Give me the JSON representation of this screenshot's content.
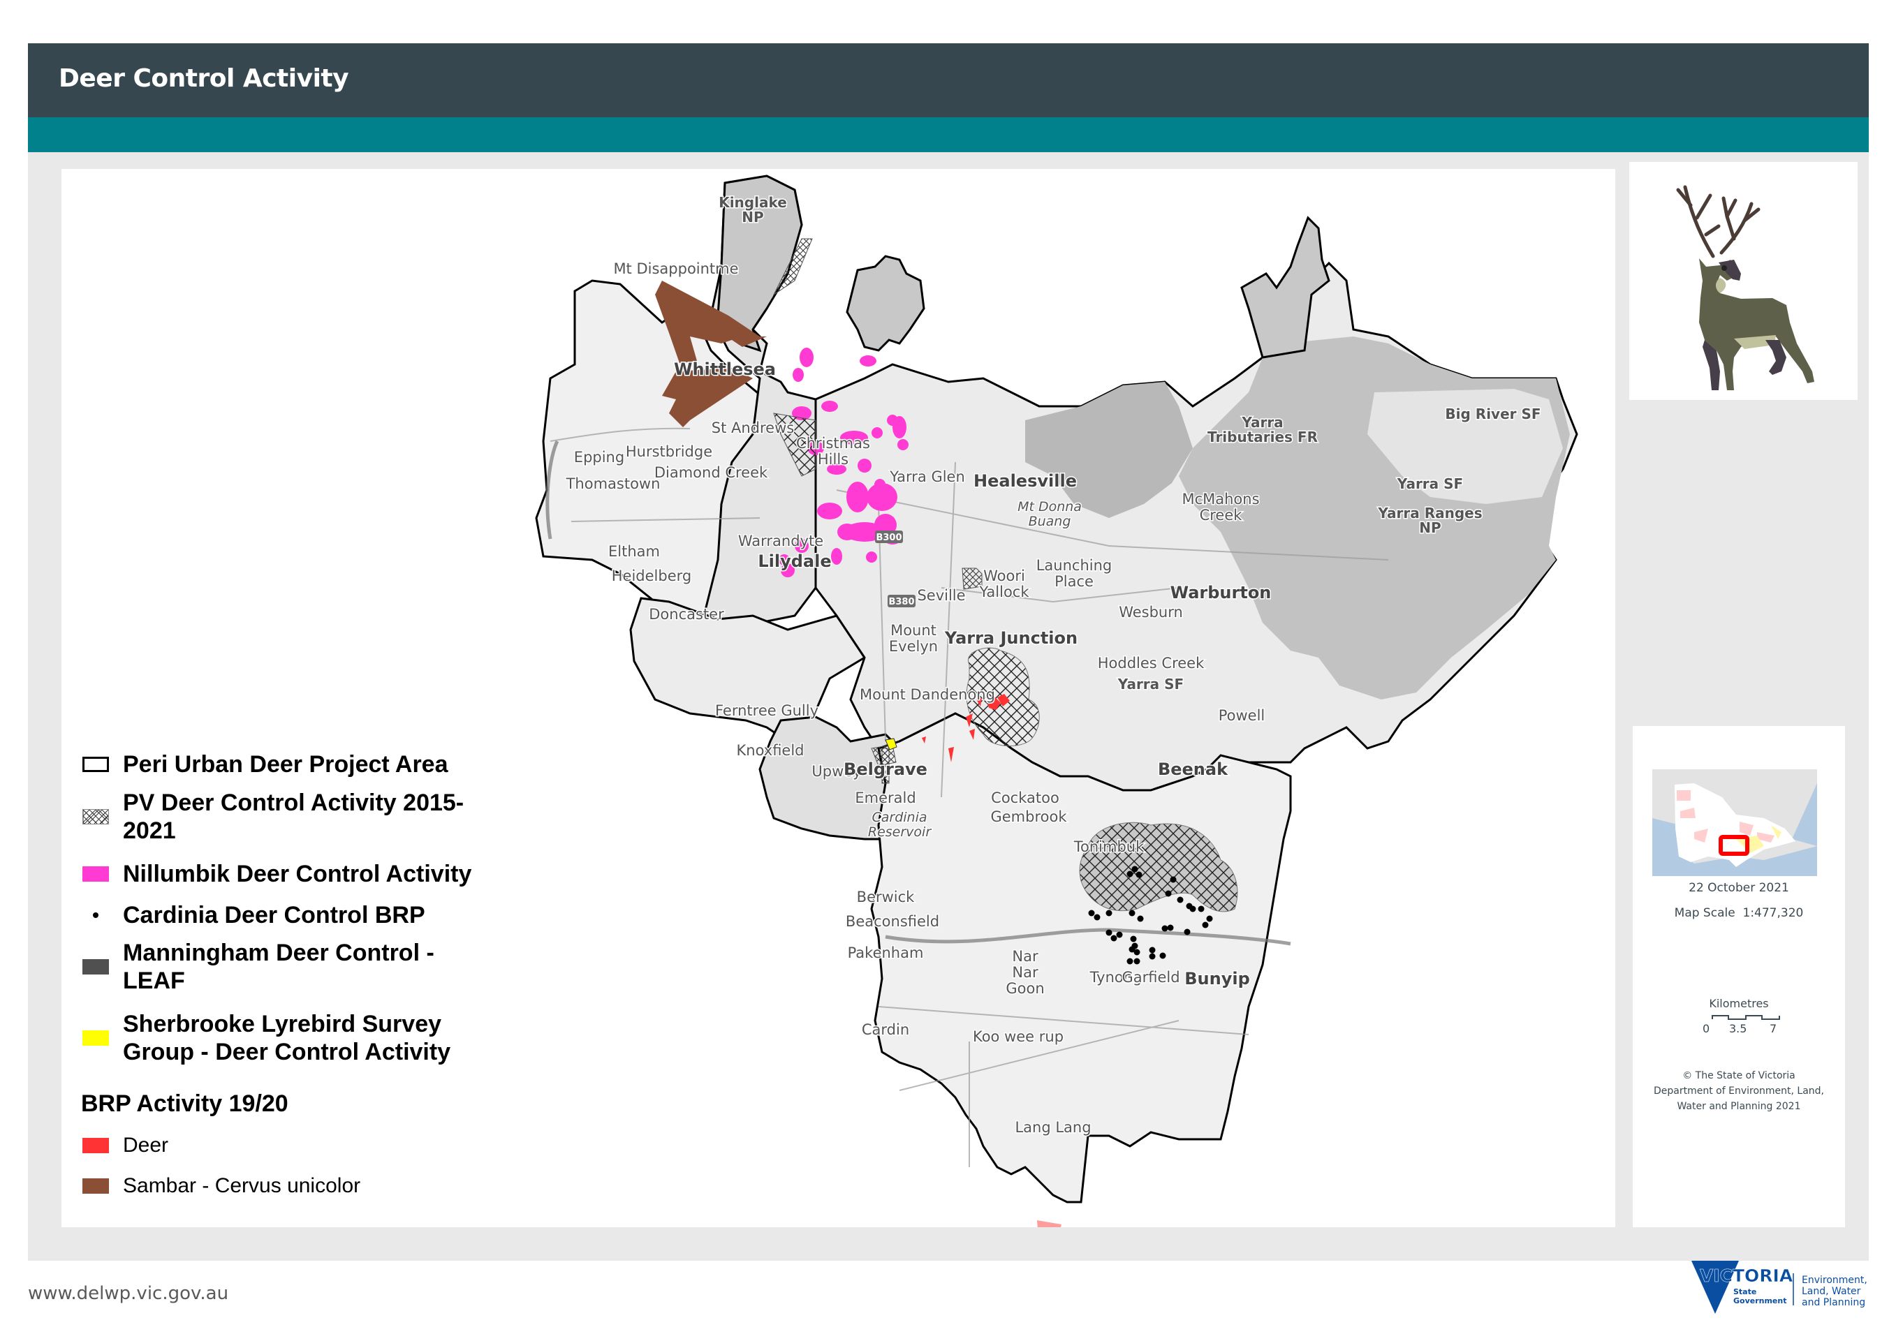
{
  "header": {
    "title": "Deer Control Activity"
  },
  "legend": {
    "items": [
      {
        "id": "peri-urban",
        "label": "Peri Urban Deer Project Area",
        "symbol": "outline-box",
        "color": "#000000"
      },
      {
        "id": "pv",
        "label": "PV Deer Control Activity 2015-2021",
        "label_line1": "PV Deer Control Activity 2015-",
        "label_line2": "2021",
        "symbol": "crosshatch",
        "color": "#000000"
      },
      {
        "id": "nillumbik",
        "label": "Nillumbik Deer Control Activity",
        "symbol": "fill",
        "color": "#ff3bd4"
      },
      {
        "id": "cardinia",
        "label": "Cardinia Deer Control BRP",
        "symbol": "dot",
        "color": "#000000"
      },
      {
        "id": "manningham",
        "label": "Manningham Deer Control - LEAF",
        "label_line1": "Manningham Deer Control -",
        "label_line2": "LEAF",
        "symbol": "fill",
        "color": "#505050"
      },
      {
        "id": "sherbrooke",
        "label": "Sherbrooke Lyrebird Survey Group - Deer Control Activity",
        "label_line1": "Sherbrooke Lyrebird Survey",
        "label_line2": "Group - Deer Control Activity",
        "symbol": "fill",
        "color": "#ffff00"
      }
    ],
    "brp_heading": "BRP Activity 19/20",
    "brp_items": [
      {
        "id": "deer",
        "label": "Deer",
        "color": "#ff3333"
      },
      {
        "id": "sambar",
        "label": "Sambar - Cervus unicolor",
        "color": "#8b4f35"
      }
    ]
  },
  "map": {
    "place_labels": [
      {
        "name": "Kinglake NP",
        "lines": [
          "Kinglake",
          "NP"
        ],
        "type": "park"
      },
      {
        "name": "Mt Disappointment",
        "lines": [
          "Mt Disappointme"
        ],
        "type": "town"
      },
      {
        "name": "Whittlesea",
        "lines": [
          "Whittlesea"
        ],
        "type": "bold"
      },
      {
        "name": "St Andrews",
        "lines": [
          "St Andrews"
        ],
        "type": "town"
      },
      {
        "name": "Epping",
        "lines": [
          "Epping"
        ],
        "type": "town"
      },
      {
        "name": "Hurstbridge",
        "lines": [
          "Hurstbridge"
        ],
        "type": "town"
      },
      {
        "name": "Christmas Hills",
        "lines": [
          "Christmas",
          "Hills"
        ],
        "type": "town"
      },
      {
        "name": "Diamond Creek",
        "lines": [
          "Diamond Creek"
        ],
        "type": "town"
      },
      {
        "name": "Thomastown",
        "lines": [
          "Thomastown"
        ],
        "type": "town"
      },
      {
        "name": "Eltham",
        "lines": [
          "Eltham"
        ],
        "type": "town"
      },
      {
        "name": "Warrandyte",
        "lines": [
          "Warrandyte"
        ],
        "type": "town"
      },
      {
        "name": "Lilydale",
        "lines": [
          "Lilydale"
        ],
        "type": "bold"
      },
      {
        "name": "Heidelberg",
        "lines": [
          "Heidelberg"
        ],
        "type": "town"
      },
      {
        "name": "Doncaster",
        "lines": [
          "Doncaster"
        ],
        "type": "town"
      },
      {
        "name": "Yarra Glen",
        "lines": [
          "Yarra Glen"
        ],
        "type": "town"
      },
      {
        "name": "Healesville",
        "lines": [
          "Healesville"
        ],
        "type": "bold"
      },
      {
        "name": "Mt Donna Buang",
        "lines": [
          "Mt Donna",
          "Buang"
        ],
        "type": "italic"
      },
      {
        "name": "McMahons Creek",
        "lines": [
          "McMahons",
          "Creek"
        ],
        "type": "town"
      },
      {
        "name": "Yarra Tributaries FR",
        "lines": [
          "Yarra",
          "Tributaries FR"
        ],
        "type": "park"
      },
      {
        "name": "Big River SF",
        "lines": [
          "Big River SF"
        ],
        "type": "park"
      },
      {
        "name": "Yarra SF",
        "lines": [
          "Yarra SF"
        ],
        "type": "park"
      },
      {
        "name": "Yarra Ranges NP",
        "lines": [
          "Yarra Ranges",
          "NP"
        ],
        "type": "park"
      },
      {
        "name": "Seville",
        "lines": [
          "Seville"
        ],
        "type": "town"
      },
      {
        "name": "Woori Yallock",
        "lines": [
          "Woori",
          "Yallock"
        ],
        "type": "town"
      },
      {
        "name": "Launching Place",
        "lines": [
          "Launching",
          "Place"
        ],
        "type": "town"
      },
      {
        "name": "Warburton",
        "lines": [
          "Warburton"
        ],
        "type": "bold"
      },
      {
        "name": "Wesburn",
        "lines": [
          "Wesburn"
        ],
        "type": "town"
      },
      {
        "name": "Mount Evelyn",
        "lines": [
          "Mount",
          "Evelyn"
        ],
        "type": "town"
      },
      {
        "name": "Yarra Junction",
        "lines": [
          "Yarra Junction"
        ],
        "type": "bold"
      },
      {
        "name": "Hoddles Creek",
        "lines": [
          "Hoddles Creek"
        ],
        "type": "town"
      },
      {
        "name": "Yarra SF (south)",
        "lines": [
          "Yarra SF"
        ],
        "type": "park"
      },
      {
        "name": "Mount Dandenong",
        "lines": [
          "Mount Dandenong"
        ],
        "type": "town"
      },
      {
        "name": "Powelltown",
        "lines": [
          "Powell"
        ],
        "type": "town"
      },
      {
        "name": "Ferntree Gully",
        "lines": [
          "Ferntree Gully"
        ],
        "type": "town"
      },
      {
        "name": "Rowville/Knoxfield",
        "lines": [
          "Knoxfield"
        ],
        "type": "town"
      },
      {
        "name": "Upwey",
        "lines": [
          "Upwey"
        ],
        "type": "town"
      },
      {
        "name": "Belgrave",
        "lines": [
          "Belgrave"
        ],
        "type": "bold"
      },
      {
        "name": "Emerald",
        "lines": [
          "Emerald"
        ],
        "type": "town"
      },
      {
        "name": "Cardinia Reservoir",
        "lines": [
          "Cardinia",
          "Reservoir"
        ],
        "type": "italic"
      },
      {
        "name": "Cockatoo",
        "lines": [
          "Cockatoo"
        ],
        "type": "town"
      },
      {
        "name": "Gembrook",
        "lines": [
          "Gembrook"
        ],
        "type": "town"
      },
      {
        "name": "Tonimbuk",
        "lines": [
          "Tonimbuk"
        ],
        "type": "town"
      },
      {
        "name": "Beenak",
        "lines": [
          "Beenak"
        ],
        "type": "bold"
      },
      {
        "name": "Berwick",
        "lines": [
          "Berwick"
        ],
        "type": "town"
      },
      {
        "name": "Beaconsfield",
        "lines": [
          "Beaconsfield"
        ],
        "type": "town"
      },
      {
        "name": "Pakenham",
        "lines": [
          "Pakenham"
        ],
        "type": "town"
      },
      {
        "name": "Nar Nar Goon",
        "lines": [
          "Nar",
          "Nar",
          "Goon"
        ],
        "type": "town"
      },
      {
        "name": "Tynong",
        "lines": [
          "Tynong"
        ],
        "type": "town"
      },
      {
        "name": "Garfield",
        "lines": [
          "Garfield"
        ],
        "type": "town"
      },
      {
        "name": "Bunyip",
        "lines": [
          "Bunyip"
        ],
        "type": "bold"
      },
      {
        "name": "Cardinia",
        "lines": [
          "Cardin"
        ],
        "type": "town"
      },
      {
        "name": "Koo Wee Rup",
        "lines": [
          "Koo wee rup"
        ],
        "type": "town"
      },
      {
        "name": "Lang Lang",
        "lines": [
          "Lang Lang"
        ],
        "type": "town"
      }
    ],
    "road_shields": [
      "B300",
      "B380"
    ]
  },
  "info_panel": {
    "date": "22 October 2021",
    "map_scale_label": "Map Scale",
    "map_scale_value": "1:477,320",
    "scalebar_unit": "Kilometres",
    "scalebar_ticks": [
      "0",
      "3.5",
      "7"
    ],
    "copyright_lines": [
      "© The State of Victoria",
      "Department of Environment, Land,",
      "Water and Planning  2021"
    ]
  },
  "footer": {
    "url": "www.delwp.vic.gov.au",
    "logo": {
      "wordmark": "VICTORIA",
      "sub_lines": [
        "State",
        "Government"
      ],
      "dept_lines": [
        "Environment,",
        "Land, Water",
        "and Planning"
      ],
      "color": "#0a4ea1"
    }
  },
  "colors": {
    "header_dark": "#36474f",
    "header_teal": "#00818c",
    "frame_bg": "#e9e9e9",
    "nillumbik": "#ff3bd4",
    "deer": "#ff3333",
    "sambar": "#8b4f35",
    "manningham": "#505050",
    "sherbrooke": "#ffff00"
  }
}
